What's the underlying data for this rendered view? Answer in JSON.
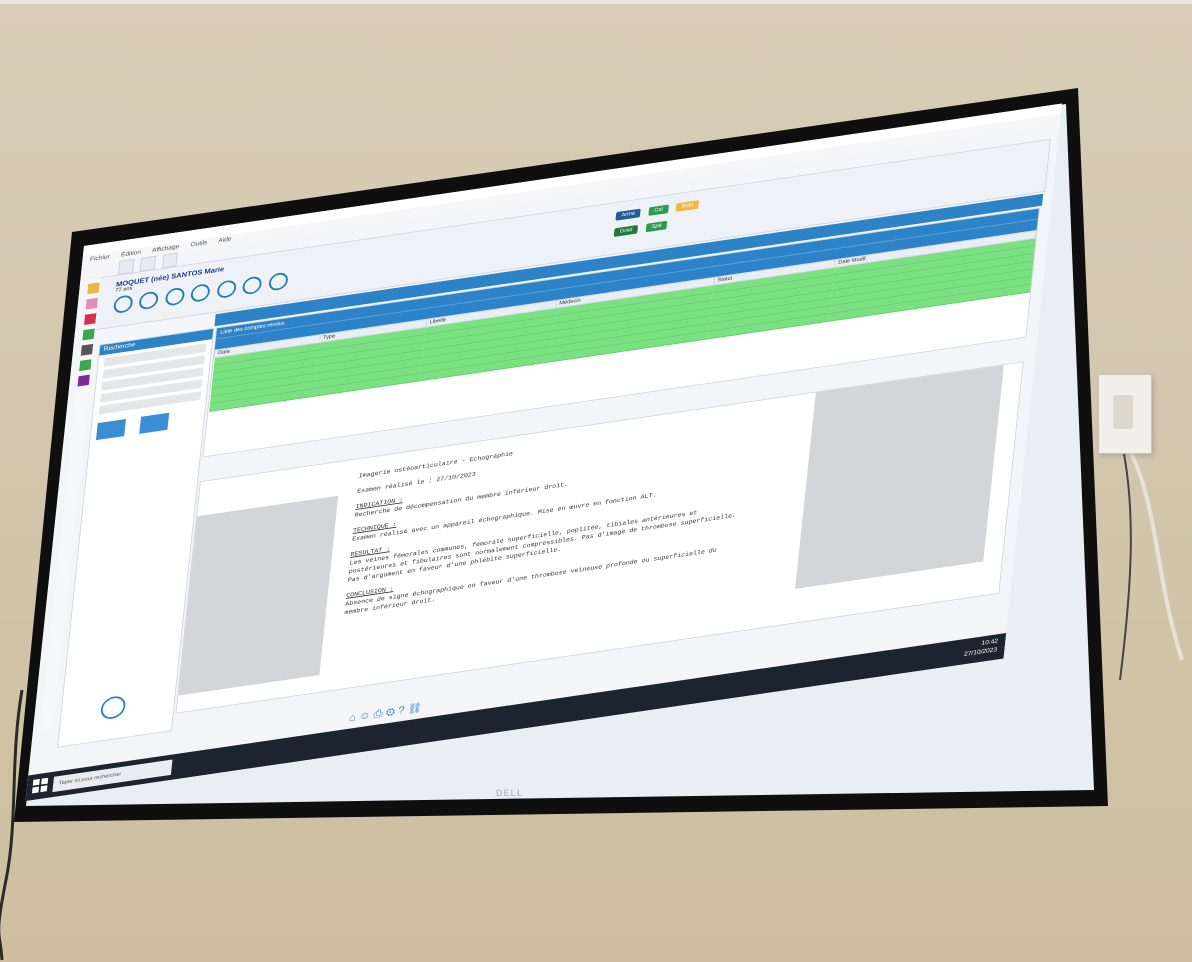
{
  "window": {
    "title": "",
    "menu": [
      "Fichier",
      "Édition",
      "Affichage",
      "Outils",
      "Aide"
    ]
  },
  "patient": {
    "name": "MOQUET (née) SANTOS Marie",
    "age": "77 ans"
  },
  "toolbar": {
    "buttons": [
      {
        "label": "Armé",
        "color": "#1e5c9a"
      },
      {
        "label": "Cal",
        "color": "#2f9b4a"
      },
      {
        "label": "Bold",
        "color": "#f0b73e"
      },
      {
        "label": "Grad",
        "color": "#1e7a3a"
      },
      {
        "label": "Spé",
        "color": "#2f9b4a"
      }
    ]
  },
  "left_panel": {
    "header": "Recherche",
    "search_icon": "search-icon"
  },
  "grid": {
    "title": "Liste des comptes rendus",
    "columns": [
      "Date",
      "Type",
      "Libellé",
      "Médecin",
      "Statut",
      "Date Modif."
    ],
    "rows": [
      {
        "date": "",
        "type": "",
        "label": "",
        "doctor": "",
        "status": "",
        "modif": ""
      },
      {
        "date": "",
        "type": "",
        "label": "",
        "doctor": "",
        "status": "",
        "modif": ""
      },
      {
        "date": "",
        "type": "",
        "label": "",
        "doctor": "",
        "status": "",
        "modif": ""
      },
      {
        "date": "",
        "type": "",
        "label": "",
        "doctor": "",
        "status": "",
        "modif": ""
      },
      {
        "date": "",
        "type": "",
        "label": "",
        "doctor": "",
        "status": "",
        "modif": ""
      },
      {
        "date": "",
        "type": "",
        "label": "",
        "doctor": "",
        "status": "",
        "modif": ""
      },
      {
        "date": "",
        "type": "",
        "label": "",
        "doctor": "",
        "status": "",
        "modif": ""
      }
    ]
  },
  "document": {
    "heading": "Imagerie ostéoarticulaire - Echographie",
    "date_line": "Examen réalisé le : 27/10/2023",
    "sections": [
      {
        "title": "INDICATION :",
        "body": "Recherche de décompensation du membre inférieur droit."
      },
      {
        "title": "TECHNIQUE :",
        "body": "Examen réalisé avec un appareil échographique. Mise en œuvre en fonction ALT."
      },
      {
        "title": "RESULTAT :",
        "body": "Les veines fémorales communes, fémorale superficielle, poplitée, tibiales antérieures et postérieures et fibulaires sont normalement compressibles. Pas d'image de thrombose superficielle. Pas d'argument en faveur d'une phlébite superficielle."
      },
      {
        "title": "CONCLUSION :",
        "body": "Absence de signe échographique en faveur d'une thrombose veineuse profonde ou superficielle du membre inférieur droit."
      }
    ]
  },
  "taskbar": {
    "search_placeholder": "Taper ici pour rechercher",
    "time": "10:42",
    "date": "27/10/2023"
  },
  "brand": "DELL"
}
